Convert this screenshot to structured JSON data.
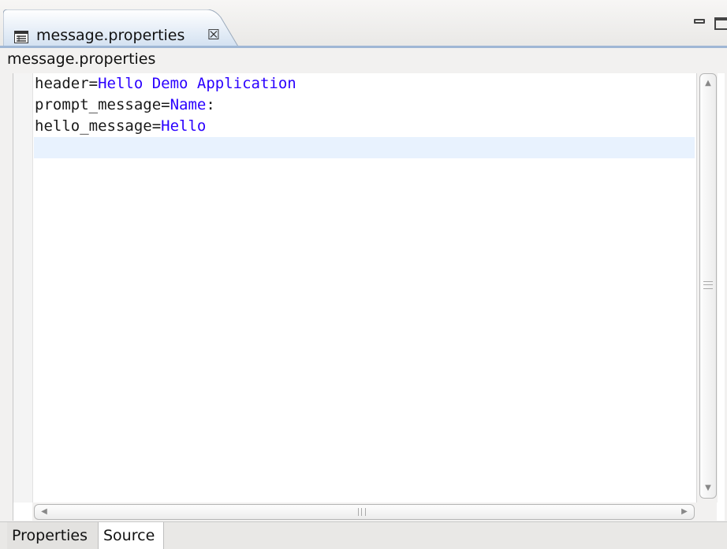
{
  "editor_tab": {
    "title": "message.properties",
    "icon": "properties-file-icon",
    "close_glyph": "☒"
  },
  "view_controls": {
    "minimize_icon": "minimize-icon",
    "maximize_icon": "maximize-icon"
  },
  "file_title": "message.properties",
  "source_lines": [
    {
      "key": "header",
      "sep": "=",
      "value": "Hello Demo Application"
    },
    {
      "key": "prompt_message",
      "sep": "=",
      "value": "Name",
      "suffix": ":"
    },
    {
      "key": "hello_message",
      "sep": "=",
      "value": "Hello"
    },
    {
      "key": "",
      "sep": "",
      "value": ""
    }
  ],
  "scrollbars": {
    "up_arrow": "▲",
    "down_arrow": "▼",
    "left_arrow": "◀",
    "right_arrow": "▶"
  },
  "bottom_tabs": {
    "properties_label": "Properties",
    "source_label": "Source"
  },
  "colors": {
    "key_text": "#1a1a1a",
    "value_text": "#2a00ff",
    "current_line_highlight": "#e8f2fe",
    "tab_underline": "#9fb7d5"
  }
}
